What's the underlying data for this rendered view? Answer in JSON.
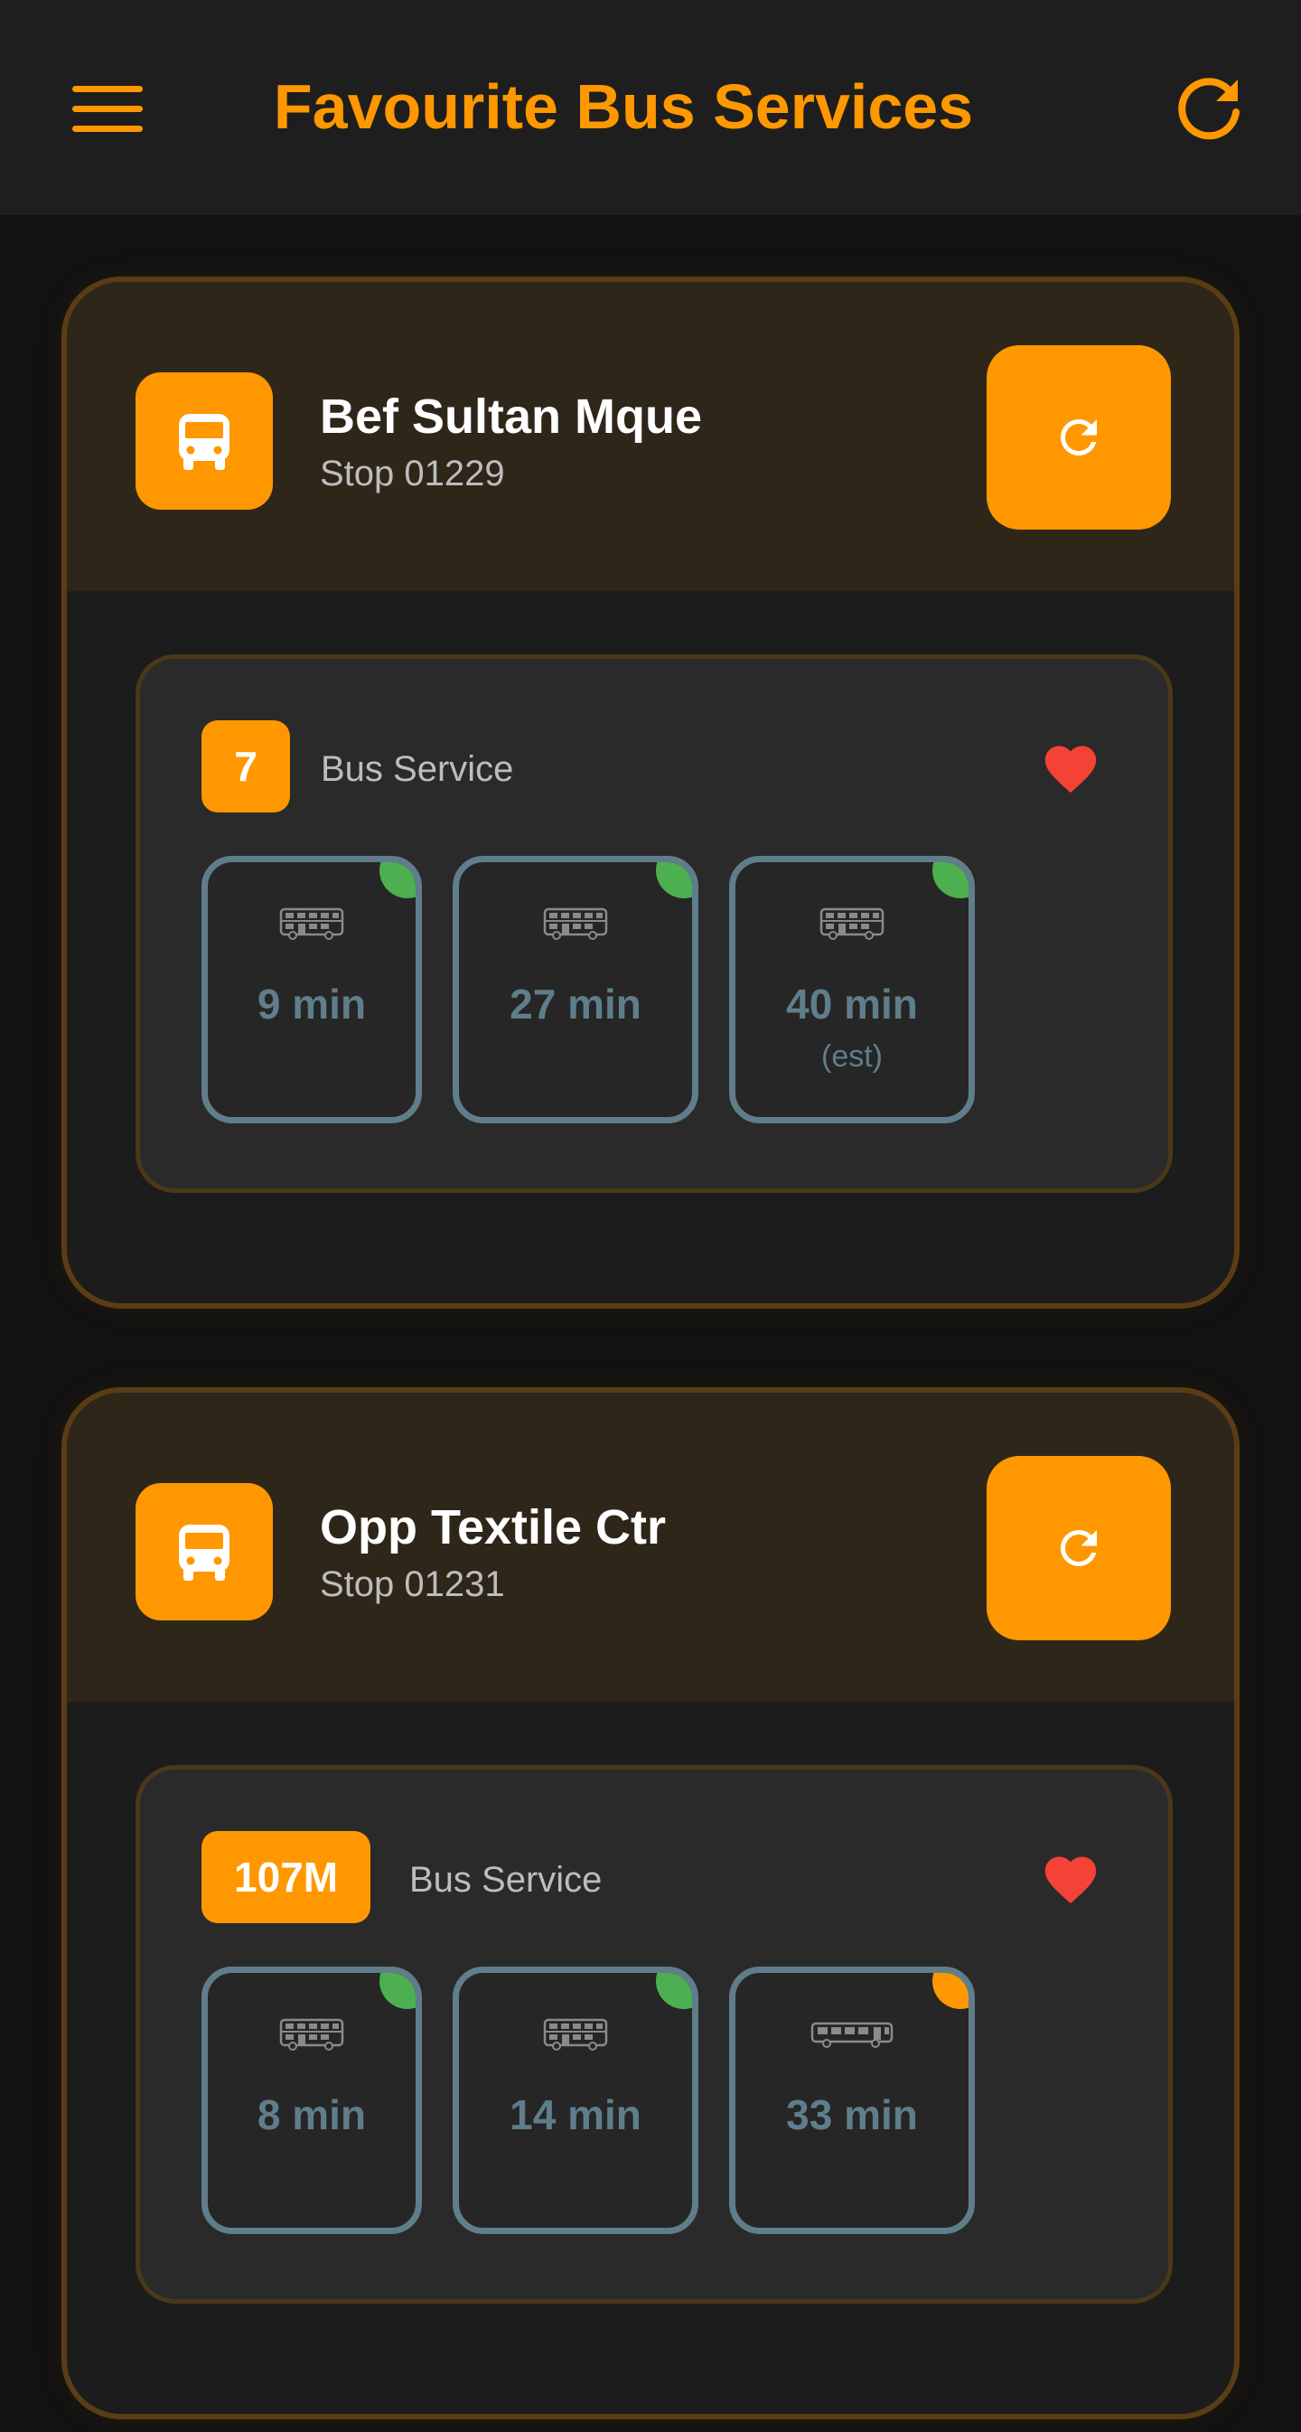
{
  "app": {
    "title": "Favourite Bus Services",
    "accent": "#ff9800",
    "menu_icon": "hamburger-menu-icon",
    "refresh_icon": "refresh-icon"
  },
  "stops": [
    {
      "name": "Bef Sultan Mque",
      "code": "Stop 01229",
      "services": [
        {
          "number": "7",
          "label": "Bus Service",
          "favourite": true,
          "arrivals": [
            {
              "eta": "9 min",
              "note": "",
              "bus_type": "double-decker",
              "load_color": "#4caf50"
            },
            {
              "eta": "27 min",
              "note": "",
              "bus_type": "double-decker",
              "load_color": "#4caf50"
            },
            {
              "eta": "40 min",
              "note": "(est)",
              "bus_type": "double-decker",
              "load_color": "#4caf50"
            }
          ]
        }
      ]
    },
    {
      "name": "Opp Textile Ctr",
      "code": "Stop 01231",
      "services": [
        {
          "number": "107M",
          "label": "Bus Service",
          "favourite": true,
          "arrivals": [
            {
              "eta": "8 min",
              "note": "",
              "bus_type": "double-decker",
              "load_color": "#4caf50"
            },
            {
              "eta": "14 min",
              "note": "",
              "bus_type": "double-decker",
              "load_color": "#4caf50"
            },
            {
              "eta": "33 min",
              "note": "",
              "bus_type": "single-deck",
              "load_color": "#ff9800"
            }
          ]
        }
      ]
    }
  ]
}
